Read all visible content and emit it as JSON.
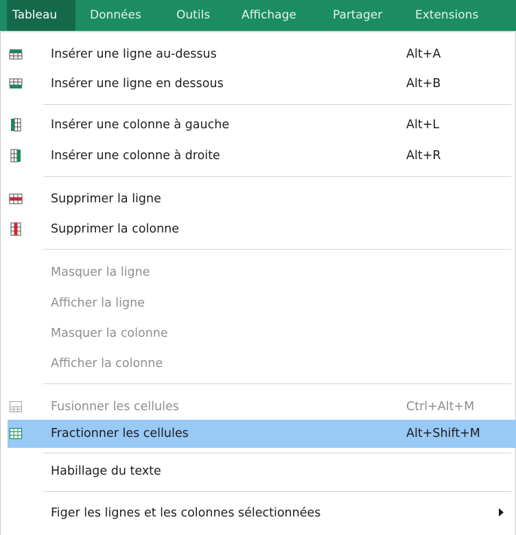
{
  "menubar": {
    "items": [
      {
        "label": "Tableau"
      },
      {
        "label": "Données"
      },
      {
        "label": "Outils"
      },
      {
        "label": "Affichage"
      },
      {
        "label": "Partager"
      },
      {
        "label": "Extensions"
      }
    ],
    "active_item": "Tableau"
  },
  "menu": {
    "items": [
      {
        "label": "Insérer une ligne au-dessus",
        "shortcut": "Alt+A",
        "icon": "insert-row-above-icon"
      },
      {
        "label": "Insérer une ligne en dessous",
        "shortcut": "Alt+B",
        "icon": "insert-row-below-icon"
      },
      {
        "label": "Insérer une colonne à gauche",
        "shortcut": "Alt+L",
        "icon": "insert-column-left-icon"
      },
      {
        "label": "Insérer une colonne à droite",
        "shortcut": "Alt+R",
        "icon": "insert-column-right-icon"
      },
      {
        "label": "Supprimer la ligne",
        "icon": "delete-row-icon"
      },
      {
        "label": "Supprimer la colonne",
        "icon": "delete-column-icon"
      },
      {
        "label": "Masquer la ligne",
        "disabled": true
      },
      {
        "label": "Afficher la ligne",
        "disabled": true
      },
      {
        "label": "Masquer la colonne",
        "disabled": true
      },
      {
        "label": "Afficher la colonne",
        "disabled": true
      },
      {
        "label": "Fusionner les cellules",
        "shortcut": "Ctrl+Alt+M",
        "disabled": true,
        "icon": "merge-cells-icon"
      },
      {
        "label": "Fractionner les cellules",
        "shortcut": "Alt+Shift+M",
        "highlighted": true,
        "icon": "split-cells-icon"
      },
      {
        "label": "Habillage du texte"
      },
      {
        "label": "Figer les lignes et les colonnes sélectionnées",
        "submenu": true,
        "icon": "submenu-arrow-icon"
      }
    ]
  },
  "colors": {
    "menubar_bg": "#1c8c64",
    "menubar_active_bg": "#15694b",
    "highlight_bg": "#99c9f5",
    "disabled_text": "#8e8e8e",
    "icon_green": "#1a8a5a",
    "icon_red": "#d7262f"
  }
}
